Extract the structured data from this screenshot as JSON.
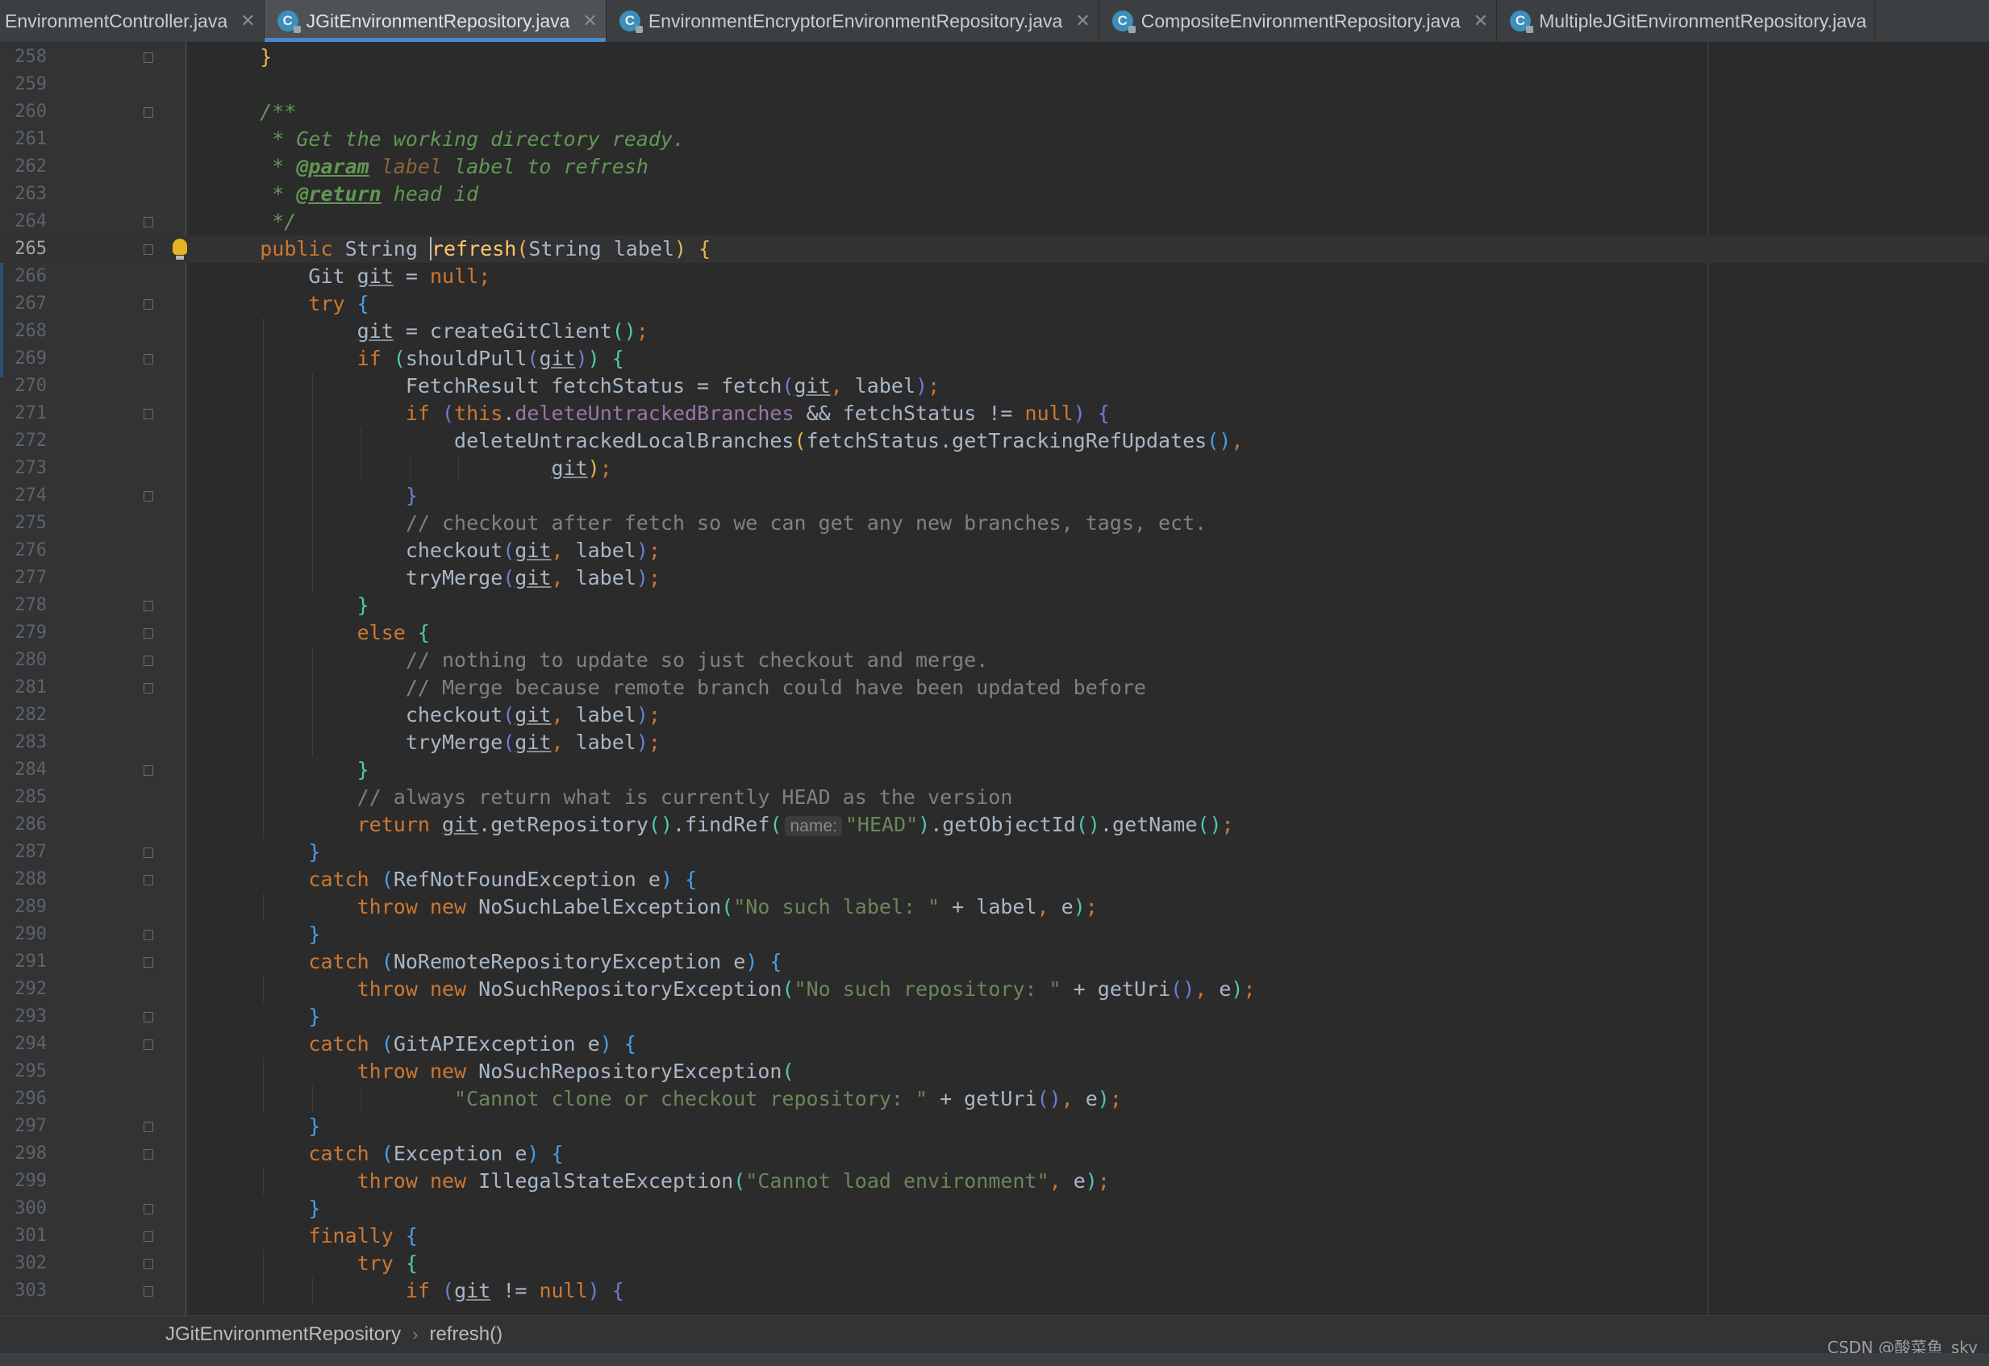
{
  "tabs": [
    {
      "label": "EnvironmentController.java",
      "active": false,
      "icon": "java-class-icon"
    },
    {
      "label": "JGitEnvironmentRepository.java",
      "active": true,
      "icon": "java-class-icon"
    },
    {
      "label": "EnvironmentEncryptorEnvironmentRepository.java",
      "active": false,
      "icon": "java-class-icon"
    },
    {
      "label": "CompositeEnvironmentRepository.java",
      "active": false,
      "icon": "java-class-icon"
    },
    {
      "label": "MultipleJGitEnvironmentRepository.java",
      "active": false,
      "icon": "java-class-icon"
    }
  ],
  "tab_icon_glyph": "C",
  "tab_close_glyph": "✕",
  "editor": {
    "current_line": 265,
    "lines": [
      {
        "n": "258",
        "code": "    }"
      },
      {
        "n": "259",
        "code": ""
      },
      {
        "n": "260",
        "code": "    /**"
      },
      {
        "n": "261",
        "code": "     * Get the working directory ready."
      },
      {
        "n": "262",
        "code": "     * @param label label to refresh"
      },
      {
        "n": "263",
        "code": "     * @return head id"
      },
      {
        "n": "264",
        "code": "     */"
      },
      {
        "n": "265",
        "code": "    public String refresh(String label) {"
      },
      {
        "n": "266",
        "code": "        Git git = null;"
      },
      {
        "n": "267",
        "code": "        try {"
      },
      {
        "n": "268",
        "code": "            git = createGitClient();"
      },
      {
        "n": "269",
        "code": "            if (shouldPull(git)) {"
      },
      {
        "n": "270",
        "code": "                FetchResult fetchStatus = fetch(git, label);"
      },
      {
        "n": "271",
        "code": "                if (this.deleteUntrackedBranches && fetchStatus != null) {"
      },
      {
        "n": "272",
        "code": "                    deleteUntrackedLocalBranches(fetchStatus.getTrackingRefUpdates(),"
      },
      {
        "n": "273",
        "code": "                            git);"
      },
      {
        "n": "274",
        "code": "                }"
      },
      {
        "n": "275",
        "code": "                // checkout after fetch so we can get any new branches, tags, ect."
      },
      {
        "n": "276",
        "code": "                checkout(git, label);"
      },
      {
        "n": "277",
        "code": "                tryMerge(git, label);"
      },
      {
        "n": "278",
        "code": "            }"
      },
      {
        "n": "279",
        "code": "            else {"
      },
      {
        "n": "280",
        "code": "                // nothing to update so just checkout and merge."
      },
      {
        "n": "281",
        "code": "                // Merge because remote branch could have been updated before"
      },
      {
        "n": "282",
        "code": "                checkout(git, label);"
      },
      {
        "n": "283",
        "code": "                tryMerge(git, label);"
      },
      {
        "n": "284",
        "code": "            }"
      },
      {
        "n": "285",
        "code": "            // always return what is currently HEAD as the version"
      },
      {
        "n": "286",
        "code": "            return git.getRepository().findRef( name: \"HEAD\").getObjectId().getName();"
      },
      {
        "n": "287",
        "code": "        }"
      },
      {
        "n": "288",
        "code": "        catch (RefNotFoundException e) {"
      },
      {
        "n": "289",
        "code": "            throw new NoSuchLabelException(\"No such label: \" + label, e);"
      },
      {
        "n": "290",
        "code": "        }"
      },
      {
        "n": "291",
        "code": "        catch (NoRemoteRepositoryException e) {"
      },
      {
        "n": "292",
        "code": "            throw new NoSuchRepositoryException(\"No such repository: \" + getUri(), e);"
      },
      {
        "n": "293",
        "code": "        }"
      },
      {
        "n": "294",
        "code": "        catch (GitAPIException e) {"
      },
      {
        "n": "295",
        "code": "            throw new NoSuchRepositoryException("
      },
      {
        "n": "296",
        "code": "                    \"Cannot clone or checkout repository: \" + getUri(), e);"
      },
      {
        "n": "297",
        "code": "        }"
      },
      {
        "n": "298",
        "code": "        catch (Exception e) {"
      },
      {
        "n": "299",
        "code": "            throw new IllegalStateException(\"Cannot load environment\", e);"
      },
      {
        "n": "300",
        "code": "        }"
      },
      {
        "n": "301",
        "code": "        finally {"
      },
      {
        "n": "302",
        "code": "            try {"
      },
      {
        "n": "303",
        "code": "                if (git != null) {"
      }
    ]
  },
  "breadcrumb": [
    "JGitEnvironmentRepository",
    "refresh()"
  ],
  "breadcrumb_separator": "›",
  "watermark": "CSDN @酸菜鱼_sky",
  "colors": {
    "background": "#2b2b2b",
    "keyword": "#cc7832",
    "method": "#ffc66d",
    "string": "#6a8759",
    "comment": "#808080",
    "doc_comment": "#629755",
    "field": "#9876aa",
    "accent": "#4a88c7"
  }
}
